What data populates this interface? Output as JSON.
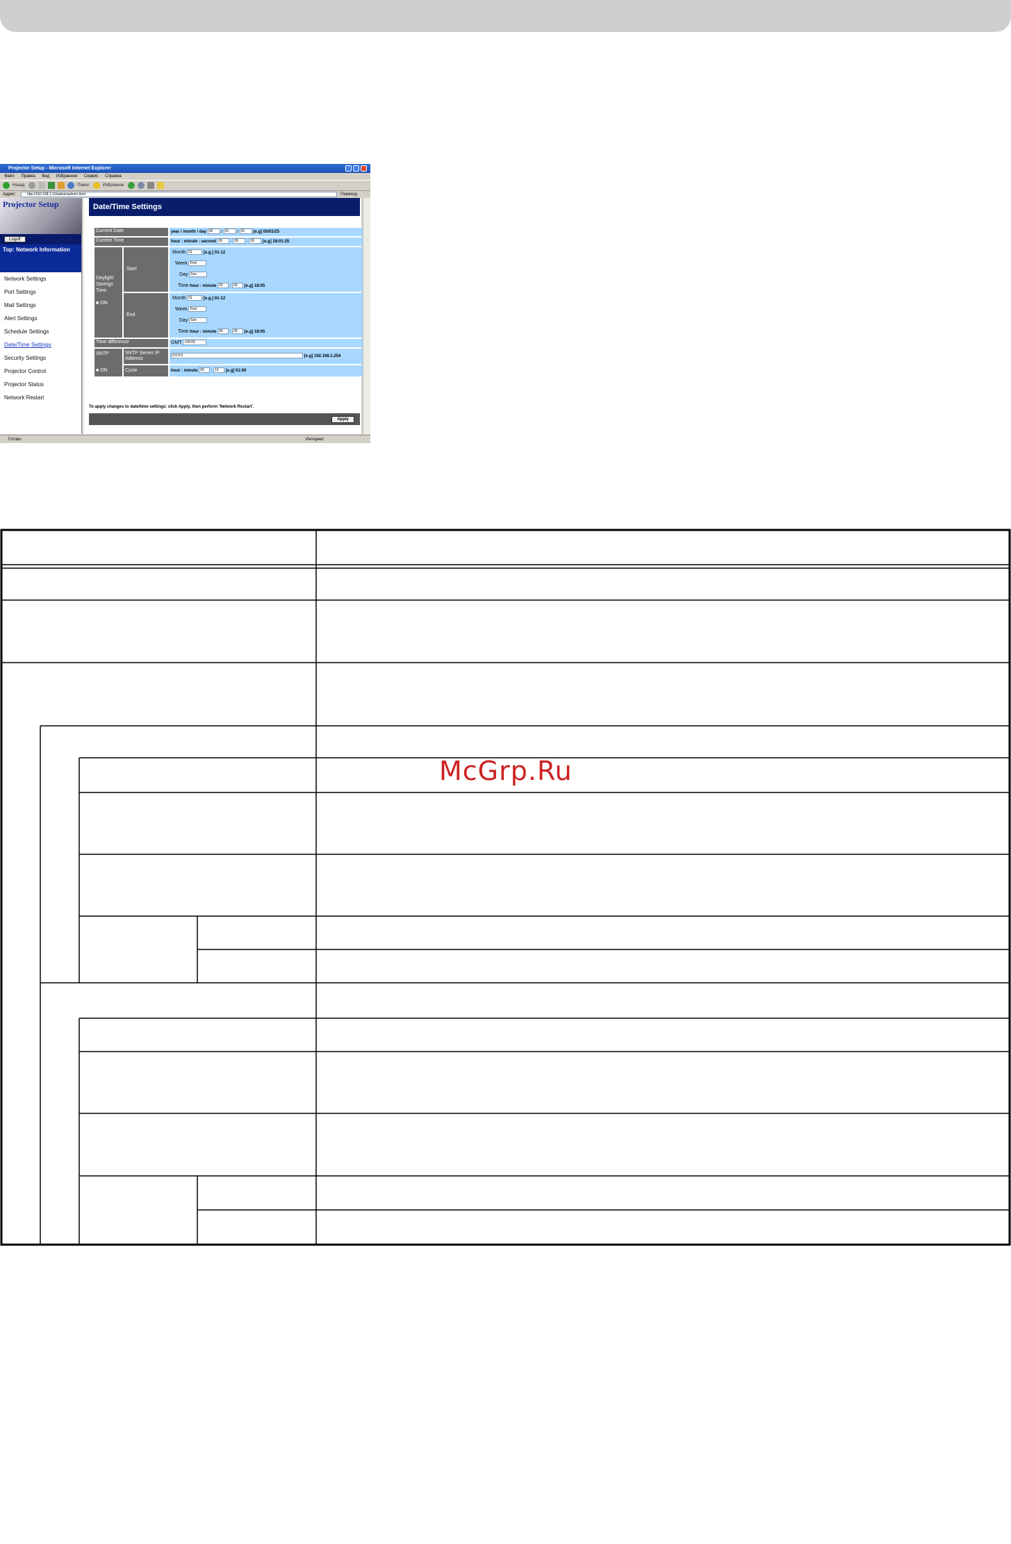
{
  "browser": {
    "title": "Projector Setup - Microsoft Internet Explorer",
    "menu": [
      "Файл",
      "Правка",
      "Вид",
      "Избранное",
      "Сервис",
      "Справка"
    ],
    "toolbar": {
      "back": "Назад",
      "search": "Поиск",
      "favorites": "Избранное"
    },
    "address_label": "Адрес:",
    "address": "http://192.168.1.10/admin/admin/.html",
    "go": "Переход",
    "status_left": "Готово",
    "status_zone": "Интернет"
  },
  "nav": {
    "logo": "Projector Setup",
    "logoff": "Logoff",
    "top_section": "Top: Network Information",
    "items": [
      {
        "label": "Network Settings"
      },
      {
        "label": "Port Settings"
      },
      {
        "label": "Mail Settings"
      },
      {
        "label": "Alert Settings"
      },
      {
        "label": "Schedule Settings"
      },
      {
        "label": "Date/Time Settings",
        "active": true
      },
      {
        "label": "Security Settings"
      },
      {
        "label": "Projector Control"
      },
      {
        "label": "Projector Status"
      },
      {
        "label": "Network Restart"
      }
    ]
  },
  "page": {
    "title": "Date/Time Settings",
    "current_date": {
      "label": "Current Date",
      "prefix": "year / month / day",
      "year": "00",
      "month": "01",
      "day": "01",
      "example": "[e.g] 05/01/25"
    },
    "current_time": {
      "label": "Current Time",
      "prefix": "hour : minute : second",
      "hour": "00",
      "minute": "00",
      "second": "00",
      "example": "[e.g] 18:01:25"
    },
    "dst": {
      "label": "Daylight Savings Time",
      "on_label": "ON",
      "start": {
        "label": "Start",
        "month_label": "Month",
        "month": "01",
        "month_hint": "[e.g.] 01-12",
        "week_label": "Week",
        "week": "First",
        "day_label": "Day",
        "day": "Sun",
        "time_label": "Time",
        "time_prefix": "hour : minute",
        "hour": "00",
        "minute": "00",
        "time_example": "[e.g] 18:05"
      },
      "end": {
        "label": "End",
        "month_label": "Month",
        "month": "01",
        "month_hint": "[e.g.] 01-12",
        "week_label": "Week",
        "week": "First",
        "day_label": "Day",
        "day": "Sun",
        "time_label": "Time",
        "time_prefix": "hour : minute",
        "hour": "00",
        "minute": "00",
        "time_example": "[e.g] 18:05"
      }
    },
    "time_difference": {
      "label": "Time difference",
      "prefix": "GMT",
      "value": "+00:00"
    },
    "sntp": {
      "label": "SNTP",
      "on_label": "ON",
      "server_label": "SNTP Server IP Address",
      "server": "0.0.0.0",
      "server_example": "[e.g] 192.168.1.254",
      "cycle_label": "Cycle",
      "cycle_prefix": "hour : minute",
      "cycle_hour": "00",
      "cycle_minute": "10",
      "cycle_example": "[e.g] 01:00"
    },
    "note": "To apply changes to date/time settings: click Apply, then perform 'Network Restart'.",
    "apply": "Apply"
  },
  "watermark": "McGrp.Ru"
}
